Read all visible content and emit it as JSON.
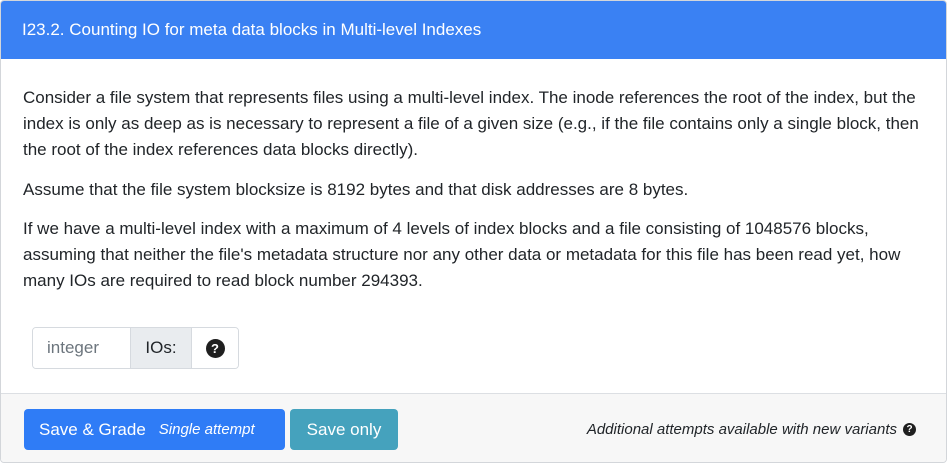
{
  "question": {
    "title": "I23.2. Counting IO for meta data blocks in Multi-level Indexes",
    "paragraphs": [
      "Consider a file system that represents files using a multi-level index. The inode references the root of the index, but the index is only as deep as is necessary to represent a file of a given size (e.g., if the file contains only a single block, then the root of the index references data blocks directly).",
      "Assume that the file system blocksize is 8192 bytes and that disk addresses are 8 bytes.",
      "If we have a multi-level index with a maximum of 4 levels of index blocks and a file consisting of 1048576 blocks, assuming that neither the file's metadata structure nor any other data or metadata for this file has been read yet, how many IOs are required to read block number 294393."
    ]
  },
  "answer": {
    "placeholder": "integer",
    "value": "",
    "unit_label": "IOs:",
    "help_icon": "question-circle-icon",
    "help_glyph": "?"
  },
  "footer": {
    "save_grade_label": "Save & Grade",
    "save_grade_sub": "Single attempt",
    "save_only_label": "Save only",
    "attempts_note": "Additional attempts available with new variants",
    "attempts_help_glyph": "?"
  },
  "colors": {
    "header_bg": "#3a81f3",
    "primary_button": "#2f7cf6",
    "info_button": "#45a2bd",
    "footer_bg": "#f7f7f7"
  }
}
